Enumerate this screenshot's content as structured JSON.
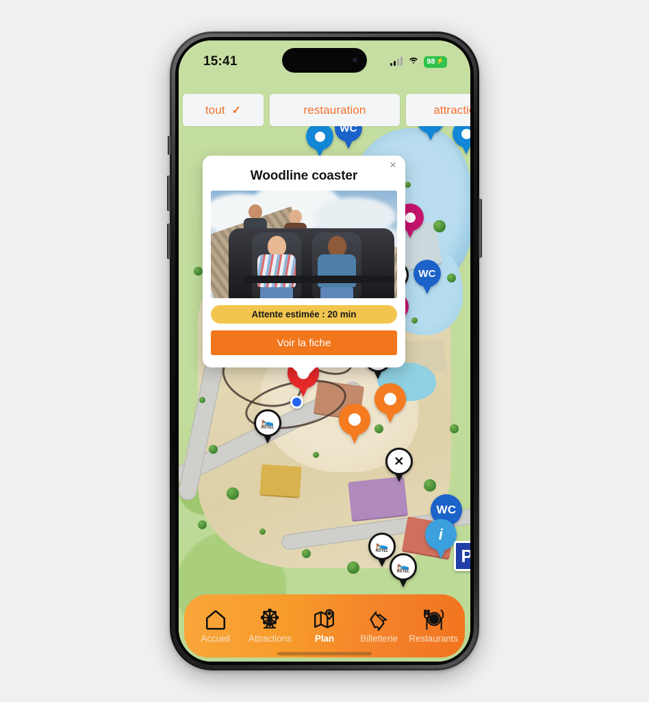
{
  "status_bar": {
    "time": "15:41",
    "battery_percent": "98",
    "battery_bolt": "⚡",
    "signal_icon": "cellular-bars-icon",
    "wifi_icon": "wifi-icon"
  },
  "filters": {
    "chips": [
      {
        "label": "tout",
        "selected": true,
        "check": "✓"
      },
      {
        "label": "restauration",
        "selected": false
      },
      {
        "label": "attractions",
        "selected": false
      }
    ]
  },
  "popup": {
    "title": "Woodline coaster",
    "close_label": "×",
    "photo_alt": "roller-coaster-riders-photo",
    "wait_label": "Attente estimée : 20 min",
    "cta_label": "Voir la fiche"
  },
  "map": {
    "markers": [
      {
        "type": "wc",
        "label": "WC",
        "color": "#1b62c9"
      },
      {
        "type": "generic",
        "label": "",
        "color": "#1386d6"
      },
      {
        "type": "info",
        "label": "i",
        "color": "#3ba0dd"
      },
      {
        "type": "attraction",
        "label": "",
        "color": "#f47b20"
      },
      {
        "type": "selected",
        "label": "",
        "color": "#e8282a"
      },
      {
        "type": "show",
        "label": "",
        "color": "#c6136b"
      },
      {
        "type": "restaurant",
        "label": "🍽",
        "color": "#141414"
      },
      {
        "type": "icecream",
        "label": "🍦",
        "color": "#141414"
      },
      {
        "type": "hotel",
        "label": "HOTEL",
        "color": "#141414"
      },
      {
        "type": "parking",
        "label": "P",
        "color": "#1f3ea8"
      }
    ],
    "user_location_label": "user-location-dot"
  },
  "tabbar": {
    "items": [
      {
        "label": "Accueil",
        "icon": "home-icon",
        "active": false
      },
      {
        "label": "Attractions",
        "icon": "ferris-wheel-icon",
        "active": false
      },
      {
        "label": "Plan",
        "icon": "map-pin-icon",
        "active": true
      },
      {
        "label": "Billetterie",
        "icon": "ticket-icon",
        "active": false
      },
      {
        "label": "Restaurants",
        "icon": "cutlery-plate-icon",
        "active": false
      }
    ]
  },
  "theme": {
    "accent_orange": "#f2761c",
    "chip_text": "#f2712a",
    "wait_yellow": "#f2c64e",
    "map_green": "#c3dc9e",
    "battery_green": "#2fc24c"
  }
}
